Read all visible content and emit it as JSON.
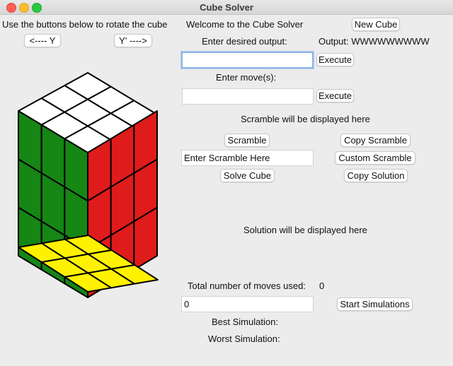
{
  "window": {
    "title": "Cube Solver"
  },
  "left": {
    "instruction": "Use the buttons below to rotate the cube",
    "rotate_y_label": "<---- Y",
    "rotate_yprime_label": "Y' ---->"
  },
  "colors": {
    "top": "#ffffff",
    "front": "#168614",
    "right": "#e01b1b",
    "bottom": "#fff200",
    "stroke": "#000000"
  },
  "main": {
    "welcome": "Welcome to the Cube Solver",
    "new_cube_label": "New Cube",
    "desired_output_label": "Enter desired output:",
    "output_text": "Output: WWWWWWWWW",
    "desired_output_value": "",
    "execute_label": "Execute",
    "moves_label": "Enter move(s):",
    "moves_value": "",
    "execute2_label": "Execute",
    "scramble_display": "Scramble will be displayed here",
    "scramble_label": "Scramble",
    "copy_scramble_label": "Copy Scramble",
    "scramble_entry_value": "Enter Scramble Here",
    "custom_scramble_label": "Custom Scramble",
    "solve_cube_label": "Solve Cube",
    "copy_solution_label": "Copy Solution",
    "solution_display": "Solution will be displayed here",
    "total_moves_label": "Total number of moves used:",
    "total_moves_value": "0",
    "simulations_value": "0",
    "start_simulations_label": "Start Simulations",
    "best_simulation_label": "Best Simulation:",
    "worst_simulation_label": "Worst Simulation:"
  }
}
